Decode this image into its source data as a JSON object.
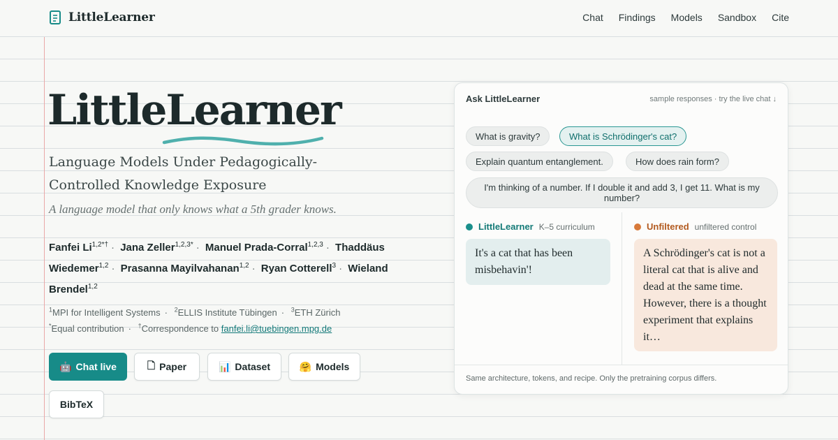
{
  "nav": {
    "brand": "LittleLearner",
    "links": [
      "Chat",
      "Findings",
      "Models",
      "Sandbox",
      "Cite"
    ]
  },
  "hero": {
    "title": "LittleLearner",
    "subtitle": "Language Models Under Pedagogically-Controlled Knowledge Exposure",
    "tagline": "A language model that only knows what a 5th grader knows."
  },
  "authors": [
    {
      "name": "Fanfei Li",
      "sup": "1,2*†"
    },
    {
      "name": "Jana Zeller",
      "sup": "1,2,3*"
    },
    {
      "name": "Manuel Prada-Corral",
      "sup": "1,2,3"
    },
    {
      "name": "Thaddäus Wiedemer",
      "sup": "1,2"
    },
    {
      "name": "Prasanna Mayilvahanan",
      "sup": "1,2"
    },
    {
      "name": "Ryan Cotterell",
      "sup": "3"
    },
    {
      "name": "Wieland Brendel",
      "sup": "1,2"
    }
  ],
  "affiliations": {
    "a1_sup": "1",
    "a1": "MPI for Intelligent Systems",
    "a2_sup": "2",
    "a2": "ELLIS Institute Tübingen",
    "a3_sup": "3",
    "a3": "ETH Zürich",
    "equal_sup": "*",
    "equal": "Equal contribution",
    "corr_sup": "†",
    "corr": "Correspondence to ",
    "email": "fanfei.li@tuebingen.mpg.de"
  },
  "buttons": {
    "chat": {
      "icon": "🤖",
      "label": "Chat live"
    },
    "paper": {
      "icon": "🗋",
      "label": "Paper"
    },
    "dataset": {
      "icon": "📊",
      "label": "Dataset"
    },
    "models": {
      "icon": "🤗",
      "label": "Models"
    },
    "bibtex": {
      "label": "BibTeX"
    }
  },
  "card": {
    "title": "Ask LittleLearner",
    "hint": "sample responses · try the live chat ↓",
    "chips": [
      "What is gravity?",
      "What is Schrödinger's cat?",
      "Explain quantum entanglement.",
      "How does rain form?",
      "I'm thinking of a number. If I double it and add 3, I get 11. What is my number?"
    ],
    "active_chip": 1,
    "left": {
      "name": "LittleLearner",
      "sub": "K–5 curriculum",
      "dot_color": "#1a8f8b",
      "response": "It's a cat that has been misbehavin'!"
    },
    "right": {
      "name": "Unfiltered",
      "sub": "unfiltered control",
      "dot_color": "#d87a3a",
      "response": "A Schrödinger's cat is not a literal cat that is alive and dead at the same time. However, there is a thought experiment that explains it…"
    },
    "footer": "Same architecture, tokens, and recipe. Only the pretraining corpus differs."
  },
  "colors": {
    "accent": "#178b88",
    "unfiltered": "#b25a1f",
    "margin_line": "#eaa7a7"
  }
}
